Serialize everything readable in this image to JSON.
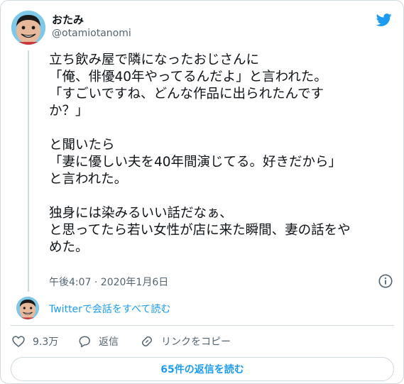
{
  "author": {
    "name": "おたみ",
    "handle": "@otamiotanomi"
  },
  "tweet": {
    "text": "立ち飲み屋で隣になったおじさんに\n「俺、俳優40年やってるんだよ」と言われた。\n「すごいですね、どんな作品に出られたんです\nか？」\n\nと聞いたら\n「妻に優しい夫を40年間演じてる。好きだから」\nと言われた。\n\n独身には染みるいい話だなぁ、\nと思ってたら若い女性が店に来た瞬間、妻の話をや\nめた。",
    "timestamp": "午後4:07 · 2020年1月6日"
  },
  "conversation_link": "Twitterで会話をすべて読む",
  "actions": {
    "like_count": "9.3万",
    "reply_label": "返信",
    "copy_link_label": "リンクをコピー"
  },
  "read_replies_button": "65件の返信を読む",
  "colors": {
    "accent": "#1d9bf0",
    "secondary_text": "#536471",
    "border": "#cfd9de"
  },
  "icons": [
    "twitter-bird-icon",
    "info-icon",
    "heart-icon",
    "reply-bubble-icon",
    "link-icon"
  ]
}
